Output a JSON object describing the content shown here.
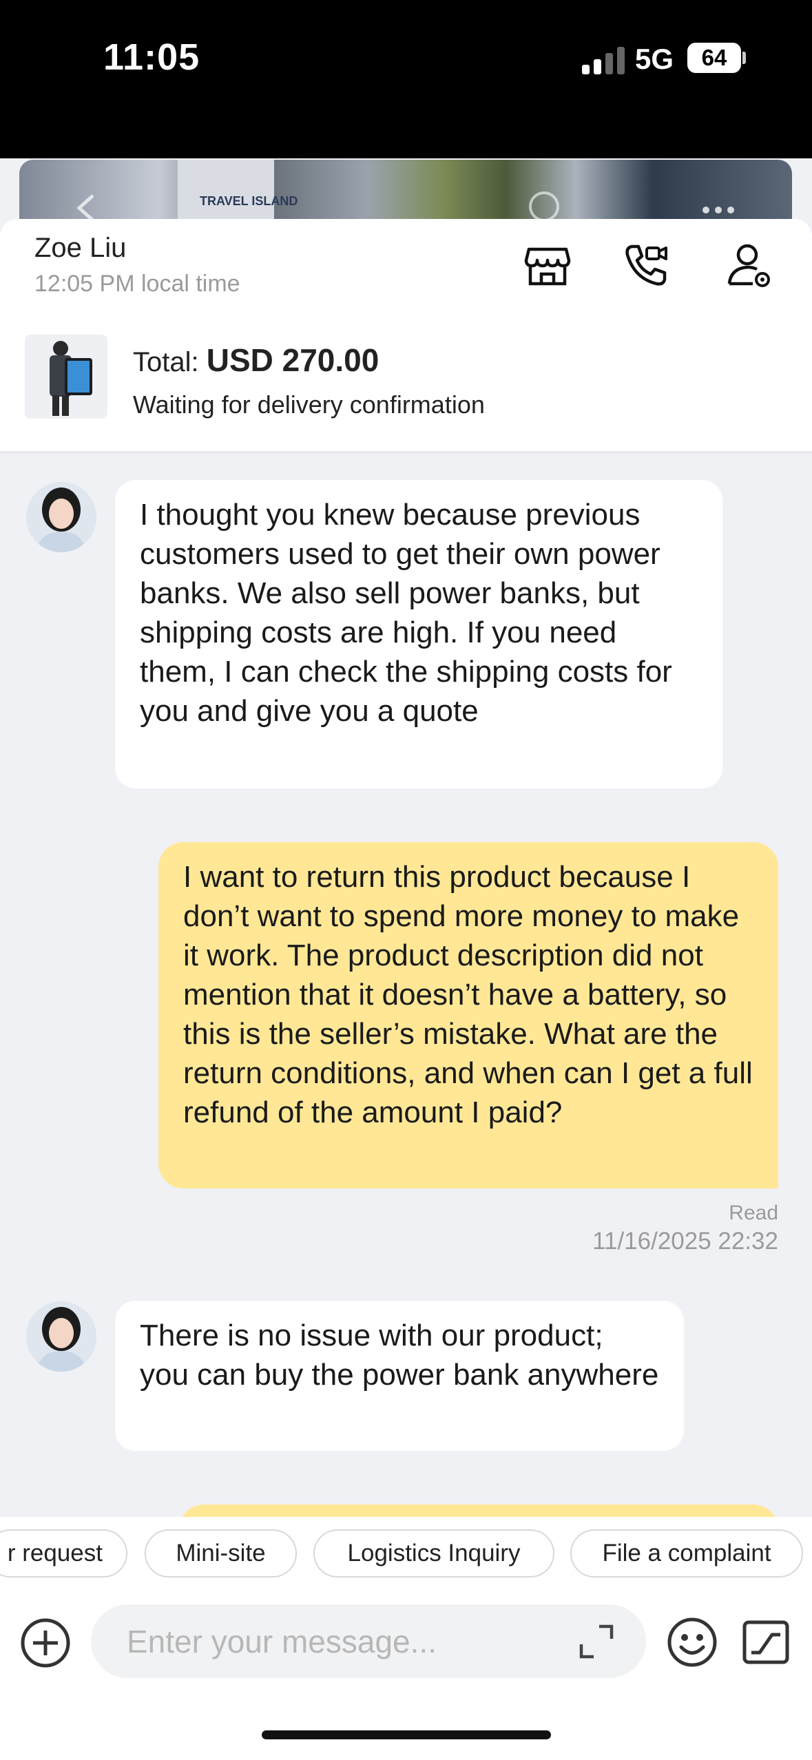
{
  "status_bar": {
    "time": "11:05",
    "network": "5G",
    "battery": "64"
  },
  "banner": {
    "poster_text": "TRAVEL ISLAND"
  },
  "contact": {
    "name": "Zoe Liu",
    "local_time": "12:05 PM local time"
  },
  "header_icons": [
    "store-icon",
    "video-call-icon",
    "profile-settings-icon"
  ],
  "order": {
    "total_label": "Total:",
    "total_value": "USD 270.00",
    "status": "Waiting for delivery confirmation"
  },
  "messages": [
    {
      "direction": "incoming",
      "text": "I thought you knew because previous customers used to get their own power banks. We also sell power banks, but shipping costs are high. If you need them, I can check the shipping costs for you and give you a quote"
    },
    {
      "direction": "outgoing",
      "text": "I want to return this product because I don’t want to spend more money to make it work. The product description did not mention that it doesn’t have a battery, so this is the seller’s mistake. What are the return conditions, and when can I get a full refund of the amount I paid?",
      "status": "Read",
      "timestamp": "11/16/2025 22:32"
    },
    {
      "direction": "incoming",
      "text": "There is no issue with our product; you can buy the power bank anywhere"
    }
  ],
  "quick_actions": [
    "r request",
    "Mini-site",
    "Logistics Inquiry",
    "File a complaint"
  ],
  "composer": {
    "placeholder": "Enter your message..."
  },
  "colors": {
    "outgoing_bubble": "#ffe796",
    "incoming_bubble": "#ffffff",
    "background": "#f0f1f5"
  }
}
